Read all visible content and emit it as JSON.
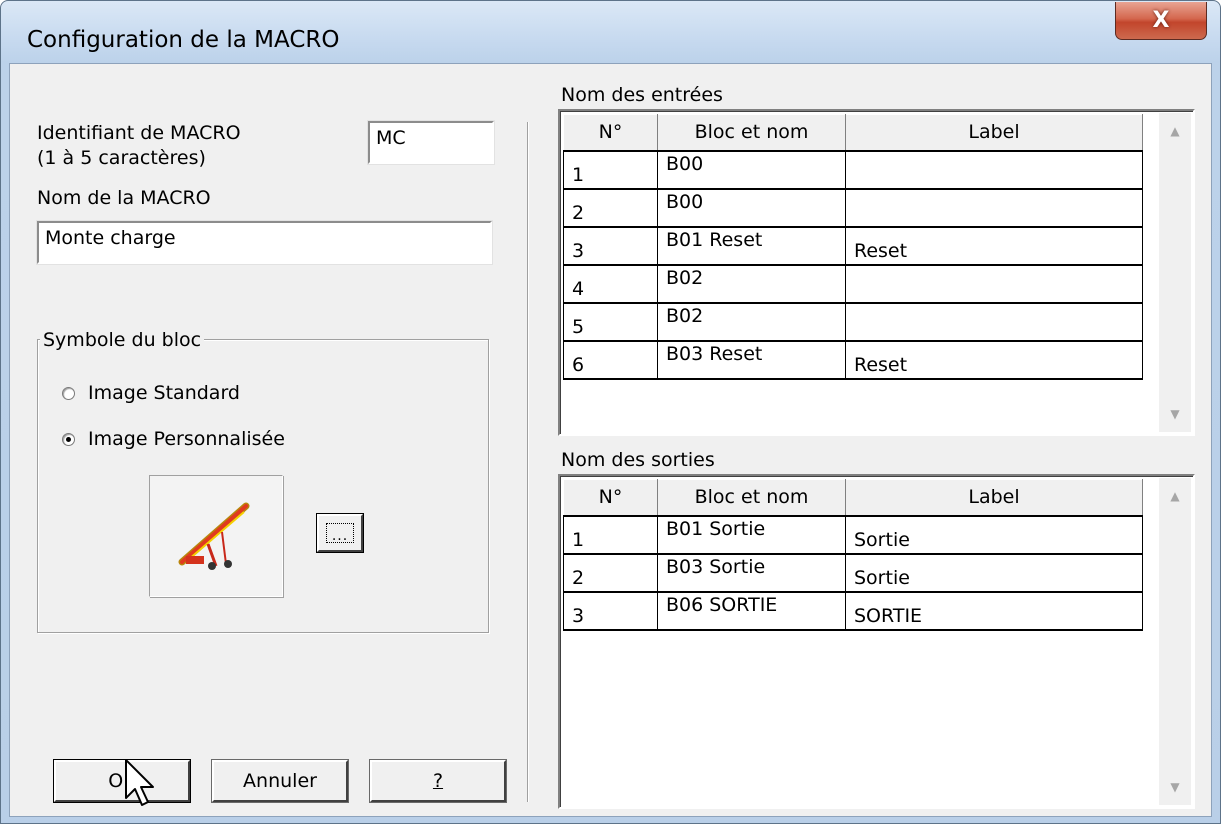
{
  "window": {
    "title": "Configuration de la MACRO",
    "close_label": "X"
  },
  "left": {
    "identifier_label": "Identifiant de MACRO",
    "identifier_hint": "(1 à 5 caractères)",
    "identifier_value": "MC",
    "name_label": "Nom de la MACRO",
    "name_value": "Monte charge",
    "symbol_group": {
      "title": "Symbole du bloc",
      "options": [
        {
          "label": "Image Standard",
          "selected": false
        },
        {
          "label": "Image Personnalisée",
          "selected": true
        }
      ],
      "image_icon": "conveyor-belt-icon",
      "browse_label": "..."
    },
    "buttons": {
      "ok": "OK",
      "cancel": "Annuler",
      "help": "?"
    }
  },
  "inputs": {
    "title": "Nom des entrées",
    "columns": [
      "N°",
      "Bloc et nom",
      "Label"
    ],
    "rows": [
      {
        "n": "1",
        "bloc": "B00",
        "label": ""
      },
      {
        "n": "2",
        "bloc": "B00",
        "label": ""
      },
      {
        "n": "3",
        "bloc": "B01 Reset",
        "label": "Reset"
      },
      {
        "n": "4",
        "bloc": "B02",
        "label": ""
      },
      {
        "n": "5",
        "bloc": "B02",
        "label": ""
      },
      {
        "n": "6",
        "bloc": "B03 Reset",
        "label": "Reset"
      }
    ]
  },
  "outputs": {
    "title": "Nom des sorties",
    "columns": [
      "N°",
      "Bloc et nom",
      "Label"
    ],
    "rows": [
      {
        "n": "1",
        "bloc": "B01 Sortie",
        "label": "Sortie"
      },
      {
        "n": "2",
        "bloc": "B03 Sortie",
        "label": "Sortie"
      },
      {
        "n": "3",
        "bloc": "B06 SORTIE",
        "label": "SORTIE"
      }
    ]
  },
  "colors": {
    "title_bar": "#c6d9ef",
    "client_bg": "#f0f0f0",
    "close_button": "#c2452c"
  }
}
